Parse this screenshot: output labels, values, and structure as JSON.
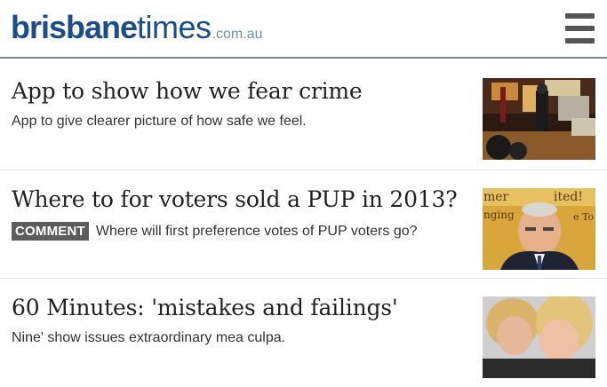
{
  "header": {
    "logo": {
      "brand": "brisbane",
      "times": "times",
      "domain": ".com.au"
    },
    "menu_icon": "hamburger-menu-icon"
  },
  "stories": [
    {
      "headline": "App to show how we fear crime",
      "summary": "App to give clearer picture of how safe we feel.",
      "thumbnail": "crime-scene-night-photo"
    },
    {
      "headline": "Where to for voters sold a PUP in 2013?",
      "tag": "COMMENT",
      "summary": "Where will first preference votes of PUP voters go?",
      "thumbnail": "politician-portrait-photo",
      "thumbnail_text": [
        "mer",
        "ited!",
        "nging",
        "e To"
      ]
    },
    {
      "headline": "60 Minutes: 'mistakes and failings'",
      "summary": "Nine' show issues extraordinary mea culpa.",
      "thumbnail": "two-women-embracing-photo"
    }
  ],
  "colors": {
    "brand": "#1b4d8c",
    "tag_bg": "#5c5c5c",
    "divider": "#7f8a96"
  }
}
